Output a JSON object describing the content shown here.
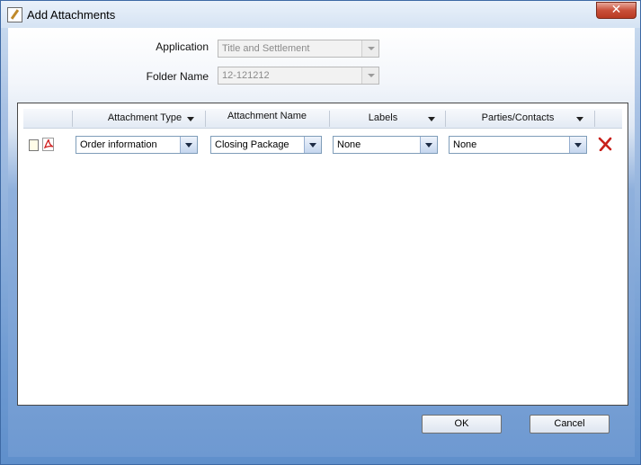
{
  "window": {
    "title": "Add Attachments",
    "close_glyph": "✕"
  },
  "form": {
    "application_label": "Application",
    "application_value": "Title and Settlement",
    "folder_label": "Folder Name",
    "folder_value": "12-121212"
  },
  "grid": {
    "headers": {
      "attachment_type": "Attachment Type",
      "attachment_name": "Attachment Name",
      "labels": "Labels",
      "parties": "Parties/Contacts"
    },
    "rows": [
      {
        "attachment_type": "Order information",
        "attachment_name": "Closing Package",
        "labels": "None",
        "parties": "None"
      }
    ]
  },
  "buttons": {
    "ok": "OK",
    "cancel": "Cancel"
  },
  "icons": {
    "app": "edit-document-icon",
    "row_doc": "document-icon",
    "row_pdf": "pdf-icon",
    "row_delete": "delete-x-icon"
  },
  "colors": {
    "delete_red": "#c8201a",
    "pdf_red": "#d02020",
    "border_blue": "#7f9db9"
  }
}
